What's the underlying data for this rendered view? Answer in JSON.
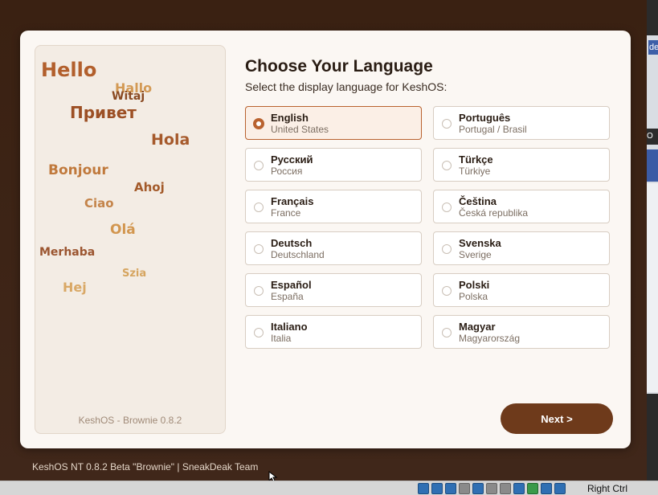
{
  "greetings": [
    {
      "text": "Hello",
      "color": "#b25f2c"
    },
    {
      "text": "Hallo",
      "color": "#d39a55"
    },
    {
      "text": "Witaj",
      "color": "#8a4a22"
    },
    {
      "text": "Привет",
      "color": "#9c4f24"
    },
    {
      "text": "Hola",
      "color": "#a65a2c"
    },
    {
      "text": "Bonjour",
      "color": "#c0793c"
    },
    {
      "text": "Ahoj",
      "color": "#a35a2a"
    },
    {
      "text": "Ciao",
      "color": "#c4844a"
    },
    {
      "text": "Olá",
      "color": "#d2964f"
    },
    {
      "text": "Merhaba",
      "color": "#9b5530"
    },
    {
      "text": "Szia",
      "color": "#d6a560"
    },
    {
      "text": "Hej",
      "color": "#d9a866"
    }
  ],
  "version_label": "KeshOS  -  Brownie 0.8.2",
  "title": "Choose Your Language",
  "subtitle": "Select the display language for KeshOS:",
  "languages": [
    {
      "name": "English",
      "region": "United States",
      "selected": true
    },
    {
      "name": "Português",
      "region": "Portugal / Brasil",
      "selected": false
    },
    {
      "name": "Русский",
      "region": "Россия",
      "selected": false
    },
    {
      "name": "Türkçe",
      "region": "Türkiye",
      "selected": false
    },
    {
      "name": "Français",
      "region": "France",
      "selected": false
    },
    {
      "name": "Čeština",
      "region": "Česká republika",
      "selected": false
    },
    {
      "name": "Deutsch",
      "region": "Deutschland",
      "selected": false
    },
    {
      "name": "Svenska",
      "region": "Sverige",
      "selected": false
    },
    {
      "name": "Español",
      "region": "España",
      "selected": false
    },
    {
      "name": "Polski",
      "region": "Polska",
      "selected": false
    },
    {
      "name": "Italiano",
      "region": "Italia",
      "selected": false
    },
    {
      "name": "Magyar",
      "region": "Magyarország",
      "selected": false
    }
  ],
  "next_label": "Next  >",
  "footer": "KeshOS NT 0.8.2 Beta \"Brownie\"  |  SneakDeak Team",
  "host_key": "Right Ctrl",
  "colors": {
    "accent": "#6e3a1b",
    "selected_border": "#b9622f",
    "background": "#3d2414"
  }
}
